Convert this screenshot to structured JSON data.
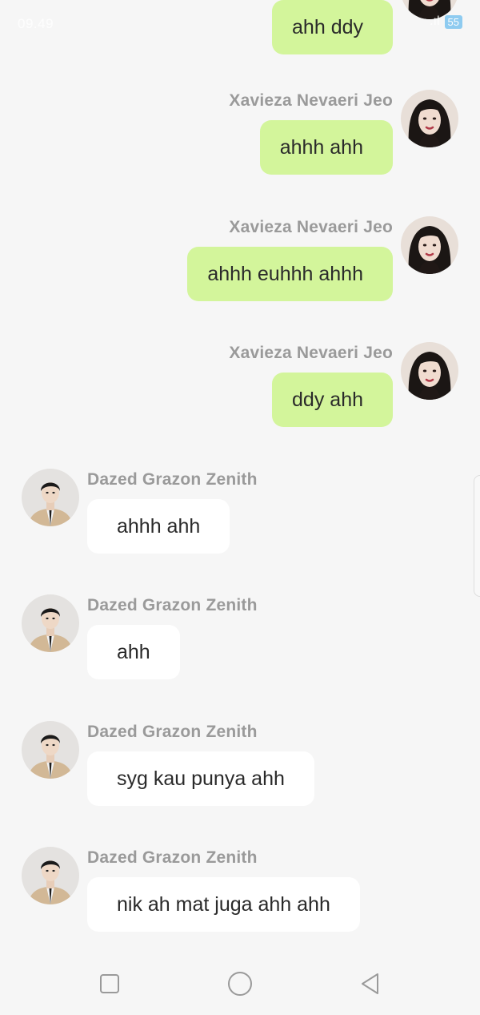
{
  "status_bar": {
    "time": "09.49",
    "signal": ".ıl",
    "battery": "55"
  },
  "colors": {
    "background": "#f6f6f6",
    "outgoing_bubble": "#d3f59b",
    "incoming_bubble": "#ffffff",
    "sender_name": "#9a9a9a",
    "message_text": "#2a2a2a"
  },
  "messages": [
    {
      "direction": "out",
      "sender": "",
      "text": "ahh ddy",
      "avatar": "woman-avatar"
    },
    {
      "direction": "out",
      "sender": "Xavieza Nevaeri Jeo",
      "text": "ahhh ahh",
      "avatar": "woman-avatar"
    },
    {
      "direction": "out",
      "sender": "Xavieza Nevaeri Jeo",
      "text": "ahhh euhhh ahhh",
      "avatar": "woman-avatar"
    },
    {
      "direction": "out",
      "sender": "Xavieza Nevaeri Jeo",
      "text": "ddy ahh",
      "avatar": "woman-avatar"
    },
    {
      "direction": "in",
      "sender": "Dazed Grazon Zenith",
      "text": "ahhh ahh",
      "avatar": "man-avatar"
    },
    {
      "direction": "in",
      "sender": "Dazed Grazon Zenith",
      "text": "ahh",
      "avatar": "man-avatar"
    },
    {
      "direction": "in",
      "sender": "Dazed Grazon Zenith",
      "text": "syg kau punya ahh",
      "avatar": "man-avatar"
    },
    {
      "direction": "in",
      "sender": "Dazed Grazon Zenith",
      "text": "nik ah mat juga ahh ahh",
      "avatar": "man-avatar"
    }
  ],
  "nav_bar": {
    "recent_icon": "square-icon",
    "home_icon": "circle-icon",
    "back_icon": "triangle-back-icon"
  }
}
